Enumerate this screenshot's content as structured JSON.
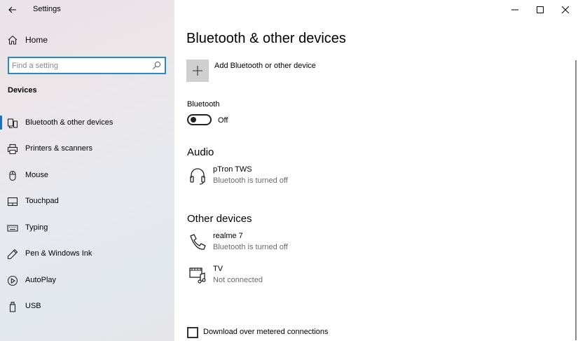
{
  "window": {
    "title": "Settings"
  },
  "sidebar": {
    "home_label": "Home",
    "search_placeholder": "Find a setting",
    "section_title": "Devices",
    "items": [
      {
        "label": "Bluetooth & other devices",
        "icon": "bluetooth-devices-icon",
        "active": true
      },
      {
        "label": "Printers & scanners",
        "icon": "printer-icon",
        "active": false
      },
      {
        "label": "Mouse",
        "icon": "mouse-icon",
        "active": false
      },
      {
        "label": "Touchpad",
        "icon": "touchpad-icon",
        "active": false
      },
      {
        "label": "Typing",
        "icon": "keyboard-icon",
        "active": false
      },
      {
        "label": "Pen & Windows Ink",
        "icon": "pen-icon",
        "active": false
      },
      {
        "label": "AutoPlay",
        "icon": "autoplay-icon",
        "active": false
      },
      {
        "label": "USB",
        "icon": "usb-icon",
        "active": false
      }
    ]
  },
  "main": {
    "title": "Bluetooth & other devices",
    "add_device_label": "Add Bluetooth or other device",
    "bluetooth_label": "Bluetooth",
    "bluetooth_state": "Off",
    "audio_title": "Audio",
    "audio_devices": [
      {
        "name": "pTron TWS",
        "status": "Bluetooth is turned off",
        "icon": "headset-icon"
      }
    ],
    "other_title": "Other devices",
    "other_devices": [
      {
        "name": "realme 7",
        "status": "Bluetooth is turned off",
        "icon": "phone-icon"
      },
      {
        "name": "TV",
        "status": "Not connected",
        "icon": "media-device-icon"
      }
    ],
    "metered_label": "Download over metered connections",
    "metered_checked": false
  },
  "colors": {
    "accent": "#1e6fb8",
    "search_border": "#2a87c8",
    "add_tile": "#cfcfcf",
    "status_text": "#6b6b6b"
  }
}
